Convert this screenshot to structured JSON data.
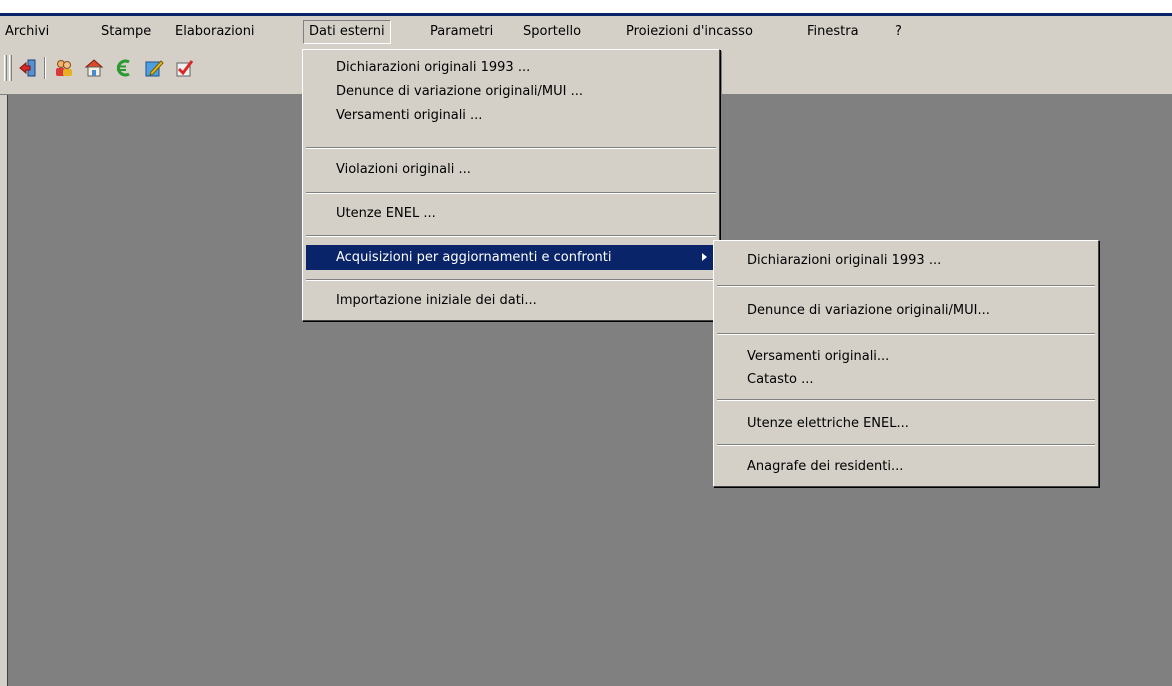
{
  "menubar": {
    "items": [
      "Archivi",
      "Stampe",
      "Elaborazioni",
      "Dati esterni",
      "Parametri",
      "Sportello",
      "Proiezioni d'incasso",
      "Finestra",
      "?"
    ]
  },
  "toolbar": {
    "icons": [
      "exit-icon",
      "people-icon",
      "house-icon",
      "euro-icon",
      "edit-icon",
      "check-icon"
    ]
  },
  "menu": {
    "items": [
      "Dichiarazioni originali 1993 ...",
      "Denunce di variazione originali/MUI ...",
      "Versamenti originali ...",
      "Violazioni originali ...",
      "Utenze ENEL ...",
      "Acquisizioni per aggiornamenti e confronti",
      "Importazione iniziale dei dati..."
    ]
  },
  "submenu": {
    "items": [
      "Dichiarazioni originali 1993 ...",
      "Denunce di variazione originali/MUI...",
      "Versamenti originali...",
      "Catasto ...",
      "Utenze elettriche ENEL...",
      "Anagrafe dei residenti..."
    ]
  },
  "colors": {
    "highlight": "#0a246a",
    "face": "#d4d0c8",
    "workspace": "#808080"
  }
}
